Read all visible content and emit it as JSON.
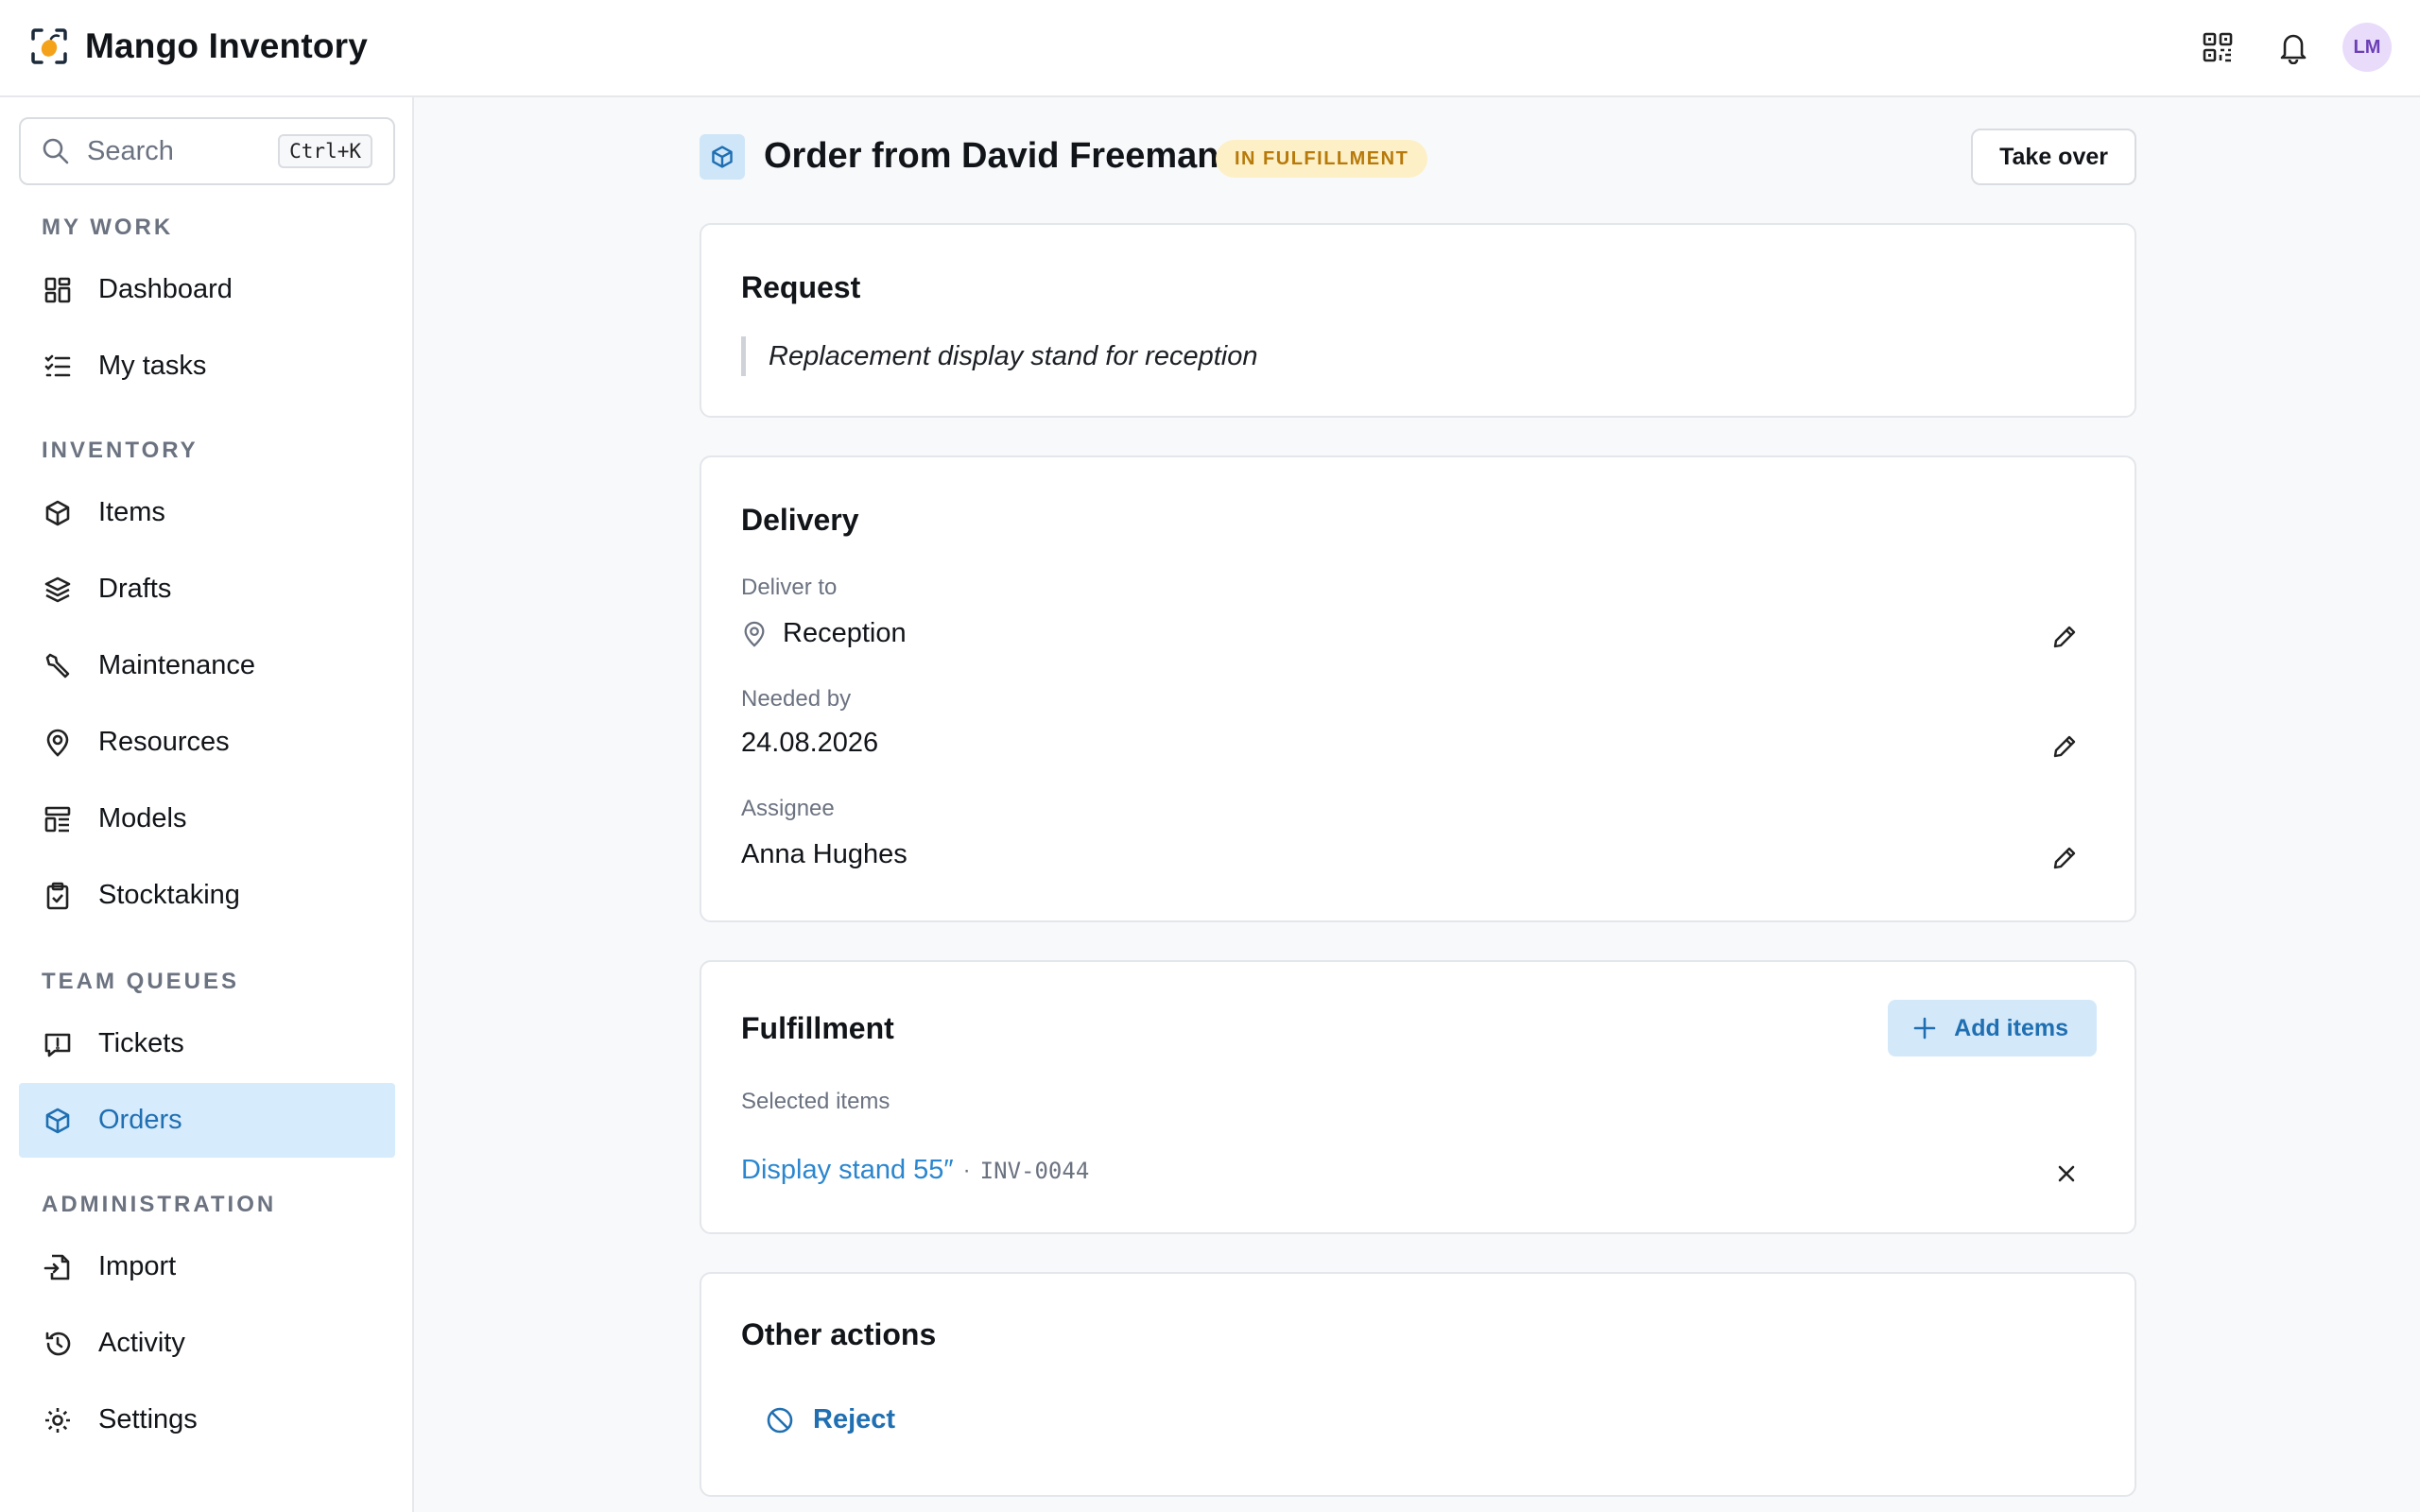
{
  "app": {
    "title": "Mango Inventory",
    "avatar_initials": "LM"
  },
  "search": {
    "placeholder": "Search",
    "shortcut": "Ctrl+K"
  },
  "sidebar": {
    "sections": [
      {
        "label": "MY WORK",
        "items": [
          {
            "label": "Dashboard",
            "icon": "dashboard-icon"
          },
          {
            "label": "My tasks",
            "icon": "checklist-icon"
          }
        ]
      },
      {
        "label": "INVENTORY",
        "items": [
          {
            "label": "Items",
            "icon": "box-icon"
          },
          {
            "label": "Drafts",
            "icon": "layers-icon"
          },
          {
            "label": "Maintenance",
            "icon": "wrench-icon"
          },
          {
            "label": "Resources",
            "icon": "location-pin-icon"
          },
          {
            "label": "Models",
            "icon": "models-icon"
          },
          {
            "label": "Stocktaking",
            "icon": "clipboard-check-icon"
          }
        ]
      },
      {
        "label": "TEAM QUEUES",
        "items": [
          {
            "label": "Tickets",
            "icon": "ticket-alert-icon"
          },
          {
            "label": "Orders",
            "icon": "box-icon",
            "active": true
          }
        ]
      },
      {
        "label": "ADMINISTRATION",
        "items": [
          {
            "label": "Import",
            "icon": "file-import-icon"
          },
          {
            "label": "Activity",
            "icon": "history-icon"
          },
          {
            "label": "Settings",
            "icon": "gear-icon"
          }
        ]
      }
    ]
  },
  "page": {
    "title": "Order from David Freeman",
    "status": "IN FULFILLMENT",
    "take_over_label": "Take over"
  },
  "request": {
    "title": "Request",
    "text": "Replacement display stand for reception"
  },
  "delivery": {
    "title": "Delivery",
    "deliver_to_label": "Deliver to",
    "deliver_to_value": "Reception",
    "needed_by_label": "Needed by",
    "needed_by_value": "24.08.2026",
    "assignee_label": "Assignee",
    "assignee_value": "Anna Hughes"
  },
  "fulfillment": {
    "title": "Fulfillment",
    "add_items_label": "Add items",
    "selected_label": "Selected items",
    "items": [
      {
        "name": "Display stand 55″",
        "separator": "·",
        "code": "INV-0044"
      }
    ]
  },
  "other_actions": {
    "title": "Other actions",
    "reject_label": "Reject"
  },
  "colors": {
    "accent": "#1f6fb2",
    "active_bg": "#d6ebfb",
    "badge_bg": "#fdf0c6",
    "badge_text": "#b7790a"
  }
}
